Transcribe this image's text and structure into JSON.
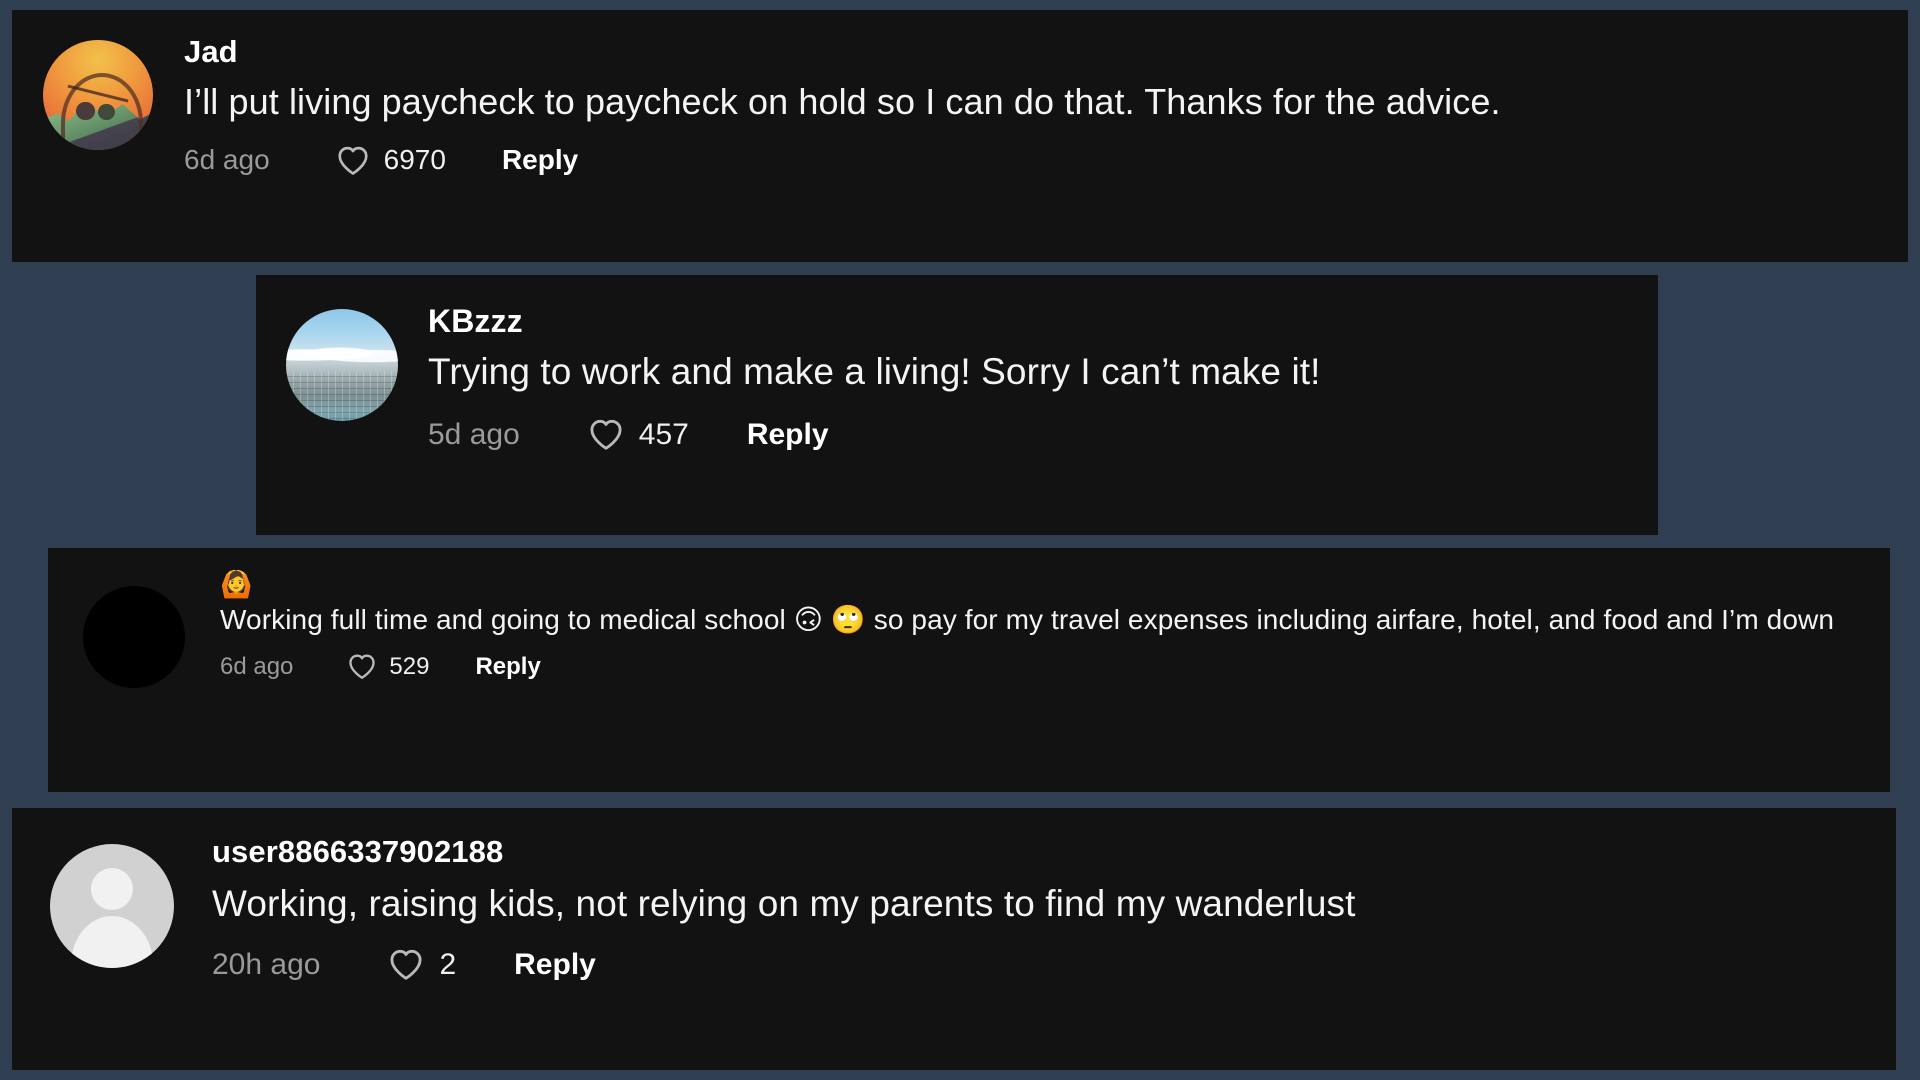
{
  "theme": {
    "page_background": "#2f3e50",
    "card_background": "#121212",
    "primary_text": "#f4f4f4",
    "muted_text": "#9a9a9a",
    "accent_text": "#ffffff"
  },
  "comments": [
    {
      "username": "Jad",
      "avatar": "illustration-avatar",
      "text": "I’ll put living paycheck to paycheck on hold so I can do that. Thanks for the advice.",
      "timestamp": "6d ago",
      "like_icon": "heart-icon",
      "likes": "6970",
      "reply_label": "Reply"
    },
    {
      "username": "KBzzz",
      "avatar": "cityscape-avatar",
      "text": "Trying to work and make a living! Sorry I can’t make it!",
      "timestamp": "5d ago",
      "like_icon": "heart-icon",
      "likes": "457",
      "reply_label": "Reply"
    },
    {
      "username": "🙆",
      "avatar": "black-avatar",
      "text_part_1": "Working full time and going to medical school ",
      "emoji_1": "🙃",
      "emoji_2": "🙄",
      "text_part_2": " so pay for my travel expenses including airfare, hotel, and food and I’m down",
      "timestamp": "6d ago",
      "like_icon": "heart-icon",
      "likes": "529",
      "reply_label": "Reply"
    },
    {
      "username": "user8866337902188",
      "avatar": "default-user-avatar",
      "text": "Working, raising kids, not relying on my parents to find my wanderlust",
      "timestamp": "20h ago",
      "like_icon": "heart-icon",
      "likes": "2",
      "reply_label": "Reply"
    }
  ]
}
